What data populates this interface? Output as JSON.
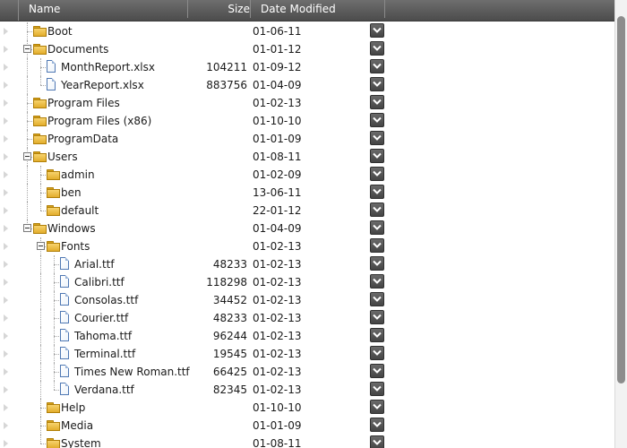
{
  "columns": {
    "name": "Name",
    "size": "Size",
    "date": "Date Modified"
  },
  "rows": [
    {
      "name": "Boot",
      "type": "folder",
      "depth": 0,
      "size": "",
      "date": "01-06-11"
    },
    {
      "name": "Documents",
      "type": "folder",
      "depth": 0,
      "expanded": true,
      "size": "",
      "date": "01-01-12"
    },
    {
      "name": "MonthReport.xlsx",
      "type": "file",
      "depth": 1,
      "size": "104211",
      "date": "01-09-12"
    },
    {
      "name": "YearReport.xlsx",
      "type": "file",
      "depth": 1,
      "size": "883756",
      "date": "01-04-09"
    },
    {
      "name": "Program Files",
      "type": "folder",
      "depth": 0,
      "size": "",
      "date": "01-02-13"
    },
    {
      "name": "Program Files (x86)",
      "type": "folder",
      "depth": 0,
      "size": "",
      "date": "01-10-10"
    },
    {
      "name": "ProgramData",
      "type": "folder",
      "depth": 0,
      "size": "",
      "date": "01-01-09"
    },
    {
      "name": "Users",
      "type": "folder",
      "depth": 0,
      "expanded": true,
      "size": "",
      "date": "01-08-11"
    },
    {
      "name": "admin",
      "type": "folder",
      "depth": 1,
      "size": "",
      "date": "01-02-09"
    },
    {
      "name": "ben",
      "type": "folder",
      "depth": 1,
      "size": "",
      "date": "13-06-11"
    },
    {
      "name": "default",
      "type": "folder",
      "depth": 1,
      "size": "",
      "date": "22-01-12"
    },
    {
      "name": "Windows",
      "type": "folder",
      "depth": 0,
      "expanded": true,
      "size": "",
      "date": "01-04-09"
    },
    {
      "name": "Fonts",
      "type": "folder",
      "depth": 1,
      "expanded": true,
      "size": "",
      "date": "01-02-13"
    },
    {
      "name": "Arial.ttf",
      "type": "file",
      "depth": 2,
      "size": "48233",
      "date": "01-02-13"
    },
    {
      "name": "Calibri.ttf",
      "type": "file",
      "depth": 2,
      "size": "118298",
      "date": "01-02-13"
    },
    {
      "name": "Consolas.ttf",
      "type": "file",
      "depth": 2,
      "size": "34452",
      "date": "01-02-13"
    },
    {
      "name": "Courier.ttf",
      "type": "file",
      "depth": 2,
      "size": "48233",
      "date": "01-02-13"
    },
    {
      "name": "Tahoma.ttf",
      "type": "file",
      "depth": 2,
      "size": "96244",
      "date": "01-02-13"
    },
    {
      "name": "Terminal.ttf",
      "type": "file",
      "depth": 2,
      "size": "19545",
      "date": "01-02-13"
    },
    {
      "name": "Times New Roman.ttf",
      "type": "file",
      "depth": 2,
      "size": "66425",
      "date": "01-02-13"
    },
    {
      "name": "Verdana.ttf",
      "type": "file",
      "depth": 2,
      "size": "82345",
      "date": "01-02-13"
    },
    {
      "name": "Help",
      "type": "folder",
      "depth": 1,
      "size": "",
      "date": "01-10-10"
    },
    {
      "name": "Media",
      "type": "folder",
      "depth": 1,
      "size": "",
      "date": "01-01-09"
    },
    {
      "name": "System",
      "type": "folder",
      "depth": 1,
      "size": "",
      "date": "01-08-11"
    }
  ],
  "icons": {
    "folder": "folder-icon",
    "file": "file-icon",
    "expander": "collapse-icon",
    "dropdown": "chevron-down-icon"
  },
  "colors": {
    "header_bg": "#5c5c5c",
    "header_text": "#ffffff",
    "folder": "#f0c24a",
    "file_border": "#4f78b3",
    "dropdown_bg": "#555555"
  }
}
